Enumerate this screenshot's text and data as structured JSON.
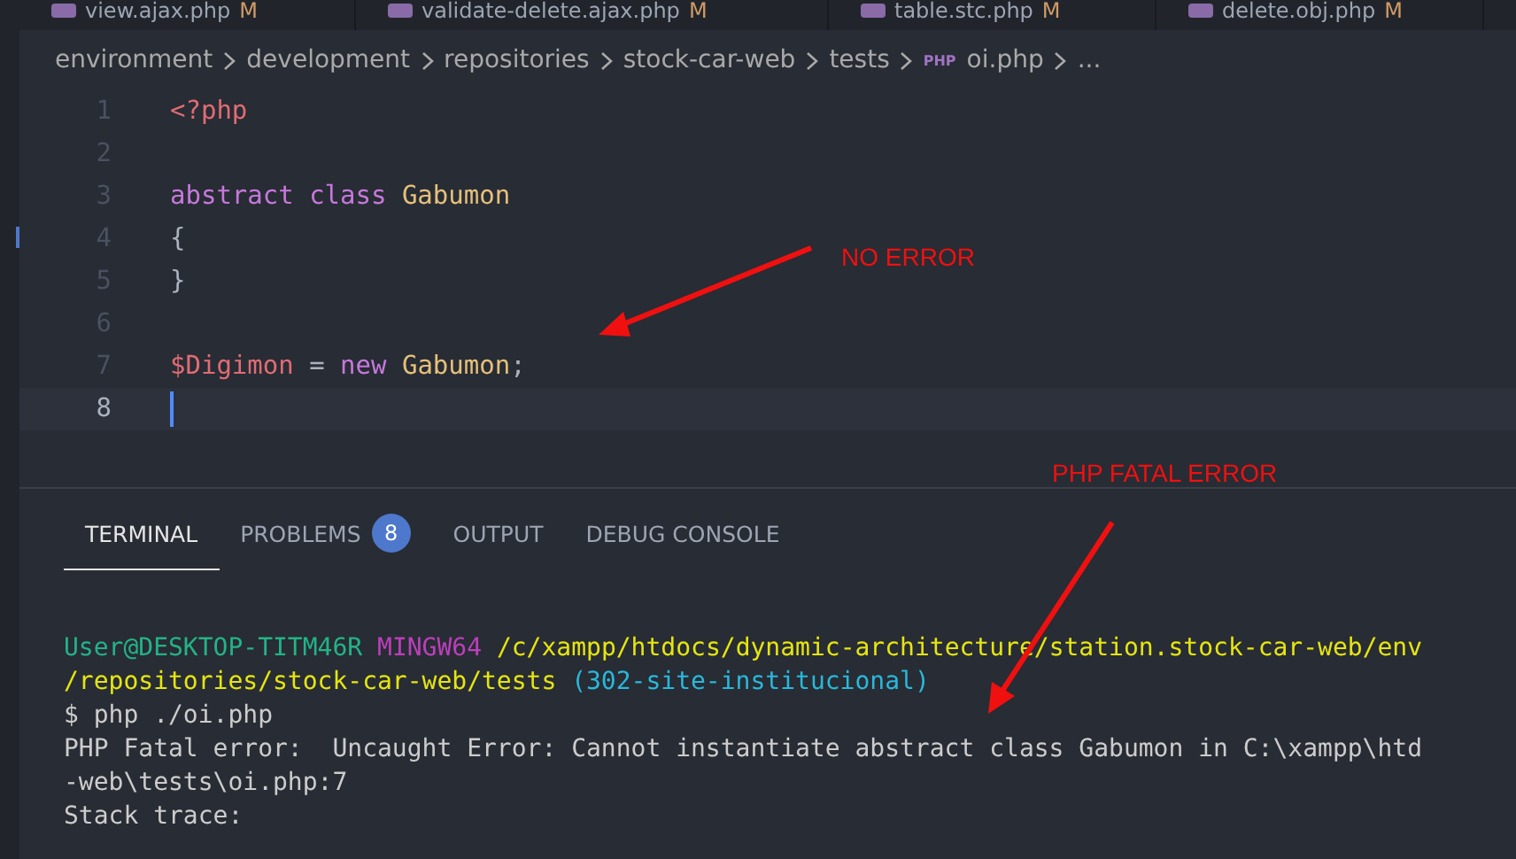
{
  "editor_tabs": [
    {
      "label": "view.ajax.php",
      "badge": "M"
    },
    {
      "label": "validate-delete.ajax.php",
      "badge": "M"
    },
    {
      "label": "table.stc.php",
      "badge": "M"
    },
    {
      "label": "delete.obj.php",
      "badge": "M"
    }
  ],
  "breadcrumb": {
    "items": [
      "environment",
      "development",
      "repositories",
      "stock-car-web",
      "tests"
    ],
    "file_icon": "PHP",
    "file": "oi.php",
    "more": "..."
  },
  "code": {
    "lines": [
      {
        "number": "1",
        "current": false,
        "tokens": [
          {
            "kind": "tag",
            "text": "<?php"
          }
        ]
      },
      {
        "number": "2",
        "current": false
      },
      {
        "number": "3",
        "current": false,
        "tokens": [
          {
            "kind": "keyword",
            "text": "abstract class "
          },
          {
            "kind": "class",
            "text": "Gabumon"
          }
        ]
      },
      {
        "number": "4",
        "current": false,
        "tokens": [
          {
            "kind": "plain",
            "text": "{"
          }
        ]
      },
      {
        "number": "5",
        "current": false,
        "tokens": [
          {
            "kind": "plain",
            "text": "}"
          }
        ]
      },
      {
        "number": "6",
        "current": false
      },
      {
        "number": "7",
        "current": false,
        "tokens": [
          {
            "kind": "variable",
            "text": "$Digimon"
          },
          {
            "kind": "plain",
            "text": " = "
          },
          {
            "kind": "keyword",
            "text": "new "
          },
          {
            "kind": "class",
            "text": "Gabumon"
          },
          {
            "kind": "plain",
            "text": ";"
          }
        ]
      },
      {
        "number": "8",
        "current": true
      }
    ]
  },
  "panel_tabs": [
    {
      "label": "TERMINAL",
      "selected": true
    },
    {
      "label": "PROBLEMS",
      "selected": false,
      "count": "8"
    },
    {
      "label": "OUTPUT",
      "selected": false
    },
    {
      "label": "DEBUG CONSOLE",
      "selected": false
    }
  ],
  "terminal": [
    [
      {
        "kind": "user",
        "text": "User@DESKTOP-TITM46R "
      },
      {
        "kind": "system",
        "text": "MINGW64 "
      },
      {
        "kind": "path",
        "text": "/c/xampp/htdocs/dynamic-architecture/station.stock-car-web/env"
      }
    ],
    [
      {
        "kind": "path",
        "text": "/repositories/stock-car-web/tests "
      },
      {
        "kind": "branch",
        "text": "(302-site-institucional)"
      }
    ],
    [
      {
        "kind": "plain",
        "text": "$ php ./oi.php"
      }
    ],
    [
      {
        "kind": "plain",
        "text": "PHP Fatal error:  Uncaught Error: Cannot instantiate abstract class Gabumon in C:\\xampp\\htd"
      }
    ],
    [
      {
        "kind": "plain",
        "text": "-web\\tests\\oi.php:7"
      }
    ],
    [
      {
        "kind": "plain",
        "text": "Stack trace:"
      }
    ]
  ],
  "annotations": [
    {
      "text": "NO ERROR"
    },
    {
      "text": "PHP FATAL ERROR"
    }
  ]
}
